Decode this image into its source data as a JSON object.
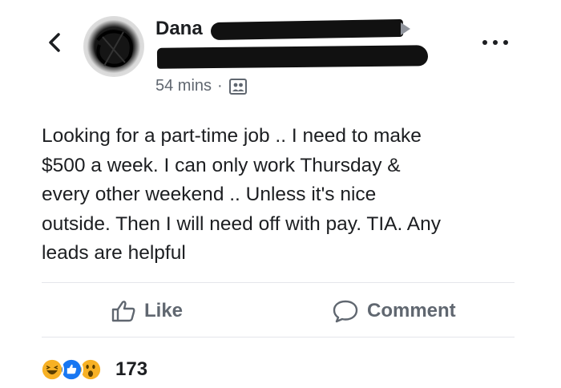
{
  "post": {
    "author_visible": "Dana",
    "timestamp": "54 mins",
    "separator": "·",
    "audience_icon": "friends-of-friends-icon",
    "text": "Looking for a part-time job .. I need to make\n$500 a week. I can only work Thursday &\nevery other weekend .. Unless it's nice\noutside. Then I will need off with pay. TIA. Any\nleads are helpful"
  },
  "actions": {
    "like_label": "Like",
    "comment_label": "Comment"
  },
  "reactions": {
    "types": [
      "haha",
      "like",
      "wow"
    ],
    "count": "173"
  },
  "colors": {
    "text": "#1c1e21",
    "secondary": "#606770",
    "like_blue": "#1877f2",
    "reaction_yellow": "#f7b125"
  }
}
